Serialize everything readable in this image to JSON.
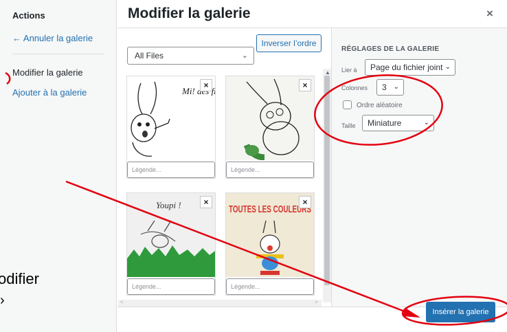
{
  "menu": {
    "title": "Actions",
    "cancel": "← Annuler la galerie",
    "current": "Modifier la galerie",
    "add": "Ajouter à la galerie"
  },
  "header": {
    "title": "Modifier la galerie",
    "close": "×"
  },
  "toolbar": {
    "reverse_label": "Inverser l’ordre",
    "filter_value": "All Files"
  },
  "tiles": [
    {
      "caption_placeholder": "Légende...",
      "remove": "×",
      "image_text": "Mi! des fra"
    },
    {
      "caption_placeholder": "Légende...",
      "remove": "×",
      "image_text": ""
    },
    {
      "caption_placeholder": "Légende...",
      "remove": "×",
      "image_text": "Youpi !"
    },
    {
      "caption_placeholder": "Légende...",
      "remove": "×",
      "image_text": "TOUTES LES COULEURS"
    }
  ],
  "settings": {
    "heading": "RÉGLAGES DE LA GALERIE",
    "link_label": "Lier à",
    "link_value": "Page du fichier joint",
    "columns_label": "Colonnes",
    "columns_value": "3",
    "random_label": "Ordre aléatoire",
    "size_label": "Taille",
    "size_value": "Miniature"
  },
  "footer": {
    "insert_label": "Insérer la galerie"
  },
  "annotation": {
    "line1": "odifier",
    "line2": "›"
  },
  "colors": {
    "accent": "#2271b1",
    "annotation": "#e3000f"
  }
}
